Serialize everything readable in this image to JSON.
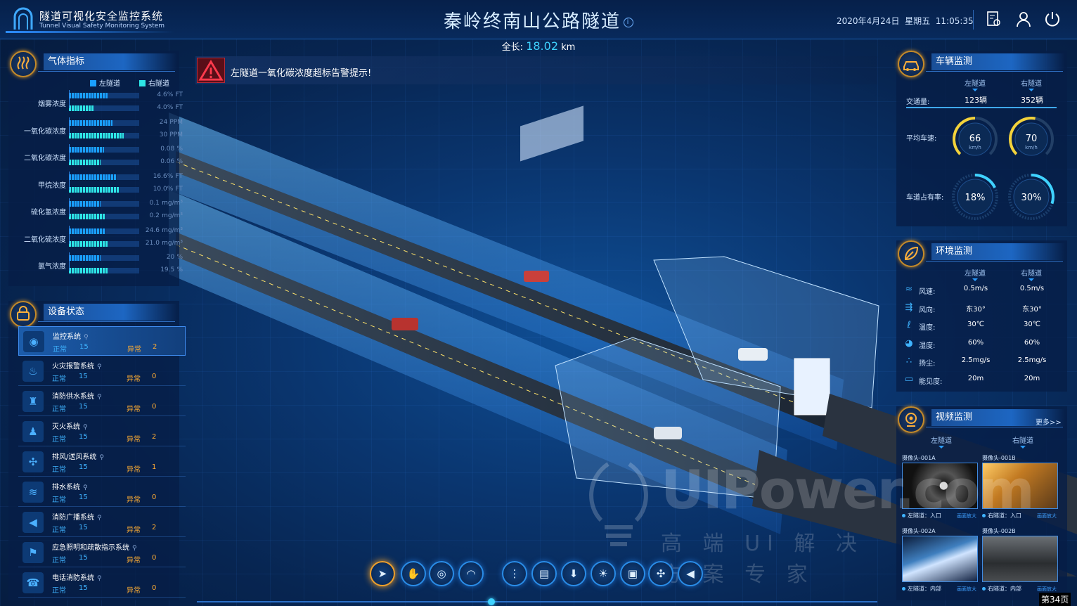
{
  "header": {
    "system_title": "隧道可视化安全监控系统",
    "system_subtitle": "Tunnel Visual Safety Monitoring System",
    "main_title": "秦岭终南山公路隧道",
    "date": "2020年4月24日",
    "weekday": "星期五",
    "time": "11:05:35",
    "length_label": "全长:",
    "length_value": "18.02",
    "length_unit": "km"
  },
  "gas": {
    "title": "气体指标",
    "legend": [
      "左隧道",
      "右隧道"
    ],
    "rows": [
      {
        "label": "烟雾浓度",
        "left": {
          "value": "4.6%",
          "unit": "FT",
          "level": 0.55
        },
        "right": {
          "value": "4.0%",
          "unit": "FT",
          "level": 0.35
        }
      },
      {
        "label": "一氧化碳浓度",
        "left": {
          "value": "24",
          "unit": "PPM",
          "level": 0.62
        },
        "right": {
          "value": "30",
          "unit": "PPM",
          "level": 0.78
        }
      },
      {
        "label": "二氧化碳浓度",
        "left": {
          "value": "0.08",
          "unit": "%",
          "level": 0.5
        },
        "right": {
          "value": "0.06",
          "unit": "%",
          "level": 0.45
        }
      },
      {
        "label": "甲烷浓度",
        "left": {
          "value": "16.6%",
          "unit": "FT",
          "level": 0.68
        },
        "right": {
          "value": "10.0%",
          "unit": "FT",
          "level": 0.72
        }
      },
      {
        "label": "硫化氢浓度",
        "left": {
          "value": "0.1",
          "unit": "mg/m³",
          "level": 0.45
        },
        "right": {
          "value": "0.2",
          "unit": "mg/m³",
          "level": 0.52
        }
      },
      {
        "label": "二氧化硫浓度",
        "left": {
          "value": "24.6",
          "unit": "mg/m³",
          "level": 0.52
        },
        "right": {
          "value": "21.0",
          "unit": "mg/m³",
          "level": 0.55
        }
      },
      {
        "label": "氯气浓度",
        "left": {
          "value": "20",
          "unit": "%",
          "level": 0.45
        },
        "right": {
          "value": "19.5",
          "unit": "%",
          "level": 0.55
        }
      }
    ]
  },
  "devices": {
    "title": "设备状态",
    "ok_label": "正常",
    "bad_label": "异常",
    "items": [
      {
        "name": "监控系统",
        "ok": "15",
        "bad": "2",
        "icon": "camera-icon",
        "glyph": "◉"
      },
      {
        "name": "火灾报警系统",
        "ok": "15",
        "bad": "0",
        "icon": "fire-icon",
        "glyph": "♨"
      },
      {
        "name": "消防供水系统",
        "ok": "15",
        "bad": "0",
        "icon": "hydrant-icon",
        "glyph": "♜"
      },
      {
        "name": "灭火系统",
        "ok": "15",
        "bad": "2",
        "icon": "extinguisher-icon",
        "glyph": "♟"
      },
      {
        "name": "排风/送风系统",
        "ok": "15",
        "bad": "1",
        "icon": "fan-icon",
        "glyph": "✣"
      },
      {
        "name": "排水系统",
        "ok": "15",
        "bad": "0",
        "icon": "drain-icon",
        "glyph": "≋"
      },
      {
        "name": "消防广播系统",
        "ok": "15",
        "bad": "2",
        "icon": "broadcast-icon",
        "glyph": "◀"
      },
      {
        "name": "应急照明和疏散指示系统",
        "ok": "15",
        "bad": "0",
        "icon": "exit-runner-icon",
        "glyph": "⚑"
      },
      {
        "name": "电话消防系统",
        "ok": "15",
        "bad": "0",
        "icon": "phone-icon",
        "glyph": "☎"
      }
    ]
  },
  "alert": {
    "text": "左隧道一氧化碳浓度超标告警提示!"
  },
  "vehicle": {
    "title": "车辆监测",
    "left_label": "左隧道",
    "right_label": "右隧道",
    "traffic_label": "交通量:",
    "traffic_left": "123辆",
    "traffic_right": "352辆",
    "speed_label": "平均车速:",
    "speed_left": "66",
    "speed_right": "70",
    "speed_unit": "km/h",
    "speed_left_level": 0.5,
    "speed_right_level": 0.54,
    "occupancy_label": "车道占有率:",
    "occ_left": "18%",
    "occ_right": "30%",
    "occ_left_level": 0.18,
    "occ_right_level": 0.3
  },
  "environment": {
    "title": "环境监测",
    "left_label": "左隧道",
    "right_label": "右隧道",
    "rows": [
      {
        "label": "风速:",
        "left": "0.5m/s",
        "right": "0.5m/s",
        "icon": "wind-icon",
        "glyph": "≈"
      },
      {
        "label": "风向:",
        "left": "东30°",
        "right": "东30°",
        "icon": "wind-vane-icon",
        "glyph": "⇶"
      },
      {
        "label": "温度:",
        "left": "30℃",
        "right": "30℃",
        "icon": "thermometer-icon",
        "glyph": "ℓ"
      },
      {
        "label": "湿度:",
        "left": "60%",
        "right": "60%",
        "icon": "humidity-icon",
        "glyph": "◕"
      },
      {
        "label": "扬尘:",
        "left": "2.5mg/s",
        "right": "2.5mg/s",
        "icon": "dust-icon",
        "glyph": "∴"
      },
      {
        "label": "能见度:",
        "left": "20m",
        "right": "20m",
        "icon": "visibility-icon",
        "glyph": "▭"
      }
    ]
  },
  "video": {
    "title": "视频监测",
    "more": "更多>>",
    "left_label": "左隧道",
    "right_label": "右隧道",
    "cams": [
      {
        "name": "摄像头-001A",
        "foot": "左隧道：入口",
        "link": "画面放大"
      },
      {
        "name": "摄像头-001B",
        "foot": "右隧道：入口",
        "link": "画面放大"
      },
      {
        "name": "摄像头-002A",
        "foot": "左隧道：内部",
        "link": "画面放大"
      },
      {
        "name": "摄像头-002B",
        "foot": "右隧道：内部",
        "link": "画面放大"
      }
    ]
  },
  "toolbar": [
    {
      "name": "pointer-tool",
      "glyph": "➤"
    },
    {
      "name": "hand-tool",
      "glyph": "✋"
    },
    {
      "name": "rotate-tool",
      "glyph": "◎"
    },
    {
      "name": "eye-tool",
      "glyph": "◠"
    },
    {
      "name": "traffic-light-tool",
      "glyph": "⋮"
    },
    {
      "name": "sign-board-tool",
      "glyph": "▤"
    },
    {
      "name": "download-tool",
      "glyph": "⬇"
    },
    {
      "name": "lamp-tool",
      "glyph": "☀"
    },
    {
      "name": "lock-tool",
      "glyph": "▣"
    },
    {
      "name": "fan-tool",
      "glyph": "✣"
    },
    {
      "name": "speaker-tool",
      "glyph": "◀"
    }
  ],
  "page": {
    "label": "第34页"
  },
  "watermark": {
    "line1": "UIPower.com",
    "line2": "高 端 UI 解 决 方 案 专 家"
  },
  "colors": {
    "left_bar": "#1aa0ff",
    "right_bar": "#2ee6e6",
    "accent": "#3fd2ff",
    "alert": "#d8243a",
    "warn": "#ffad33"
  }
}
